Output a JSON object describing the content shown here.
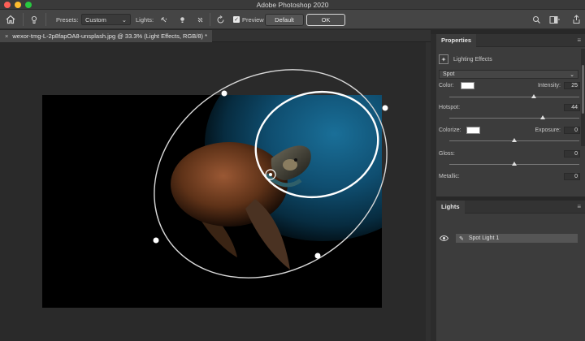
{
  "window": {
    "title": "Adobe Photoshop 2020"
  },
  "optionsbar": {
    "presets_label": "Presets:",
    "presets_value": "Custom",
    "lights_label": "Lights:",
    "preview_label": "Preview",
    "preview_checked": true,
    "default_button": "Default",
    "ok_button": "OK"
  },
  "document": {
    "tab_title": "wexor-tmg-L-2p8fapOA8-unsplash.jpg @ 33.3% (Light Effects, RGB/8) *"
  },
  "properties": {
    "tab": "Properties",
    "section_title": "Lighting Effects",
    "light_type": "Spot",
    "color_label": "Color:",
    "color_value": "#ffffff",
    "intensity_label": "Intensity:",
    "intensity_value": "25",
    "intensity_level": 0.65,
    "hotspot_label": "Hotspot:",
    "hotspot_value": "44",
    "hotspot_level": 0.72,
    "colorize_label": "Colorize:",
    "colorize_value": "#ffffff",
    "exposure_label": "Exposure:",
    "exposure_value": "0",
    "exposure_level": 0.5,
    "gloss_label": "Gloss:",
    "gloss_value": "0",
    "gloss_level": 0.5,
    "metallic_label": "Metallic:",
    "metallic_value": "0"
  },
  "lights_panel": {
    "tab": "Lights",
    "items": [
      {
        "label": "Spot Light 1",
        "visible": true
      }
    ]
  },
  "colors": {
    "accent_blue": "#1a6f98",
    "close_red": "#fe5f57",
    "minimize_yellow": "#febc2e",
    "zoom_green": "#28c840"
  }
}
